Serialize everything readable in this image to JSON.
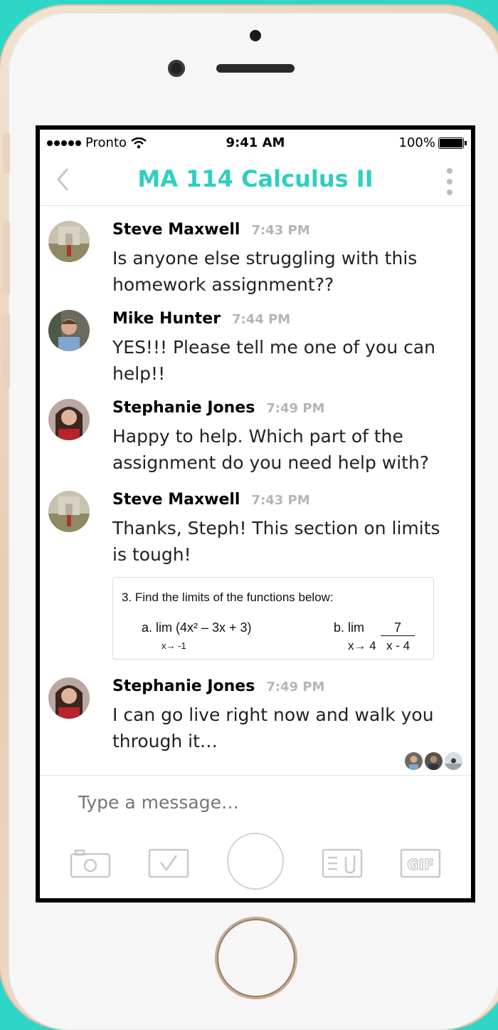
{
  "status_bar": {
    "carrier": "Pronto",
    "time": "9:41 AM",
    "battery": "100%"
  },
  "header": {
    "title": "MA 114 Calculus II",
    "back_icon": "chevron-left-icon",
    "menu_icon": "more-vertical-icon"
  },
  "colors": {
    "accent": "#2ecfc1",
    "background": "#2ed6c8",
    "timestamp": "#b5b5b5"
  },
  "messages": [
    {
      "sender": "Steve Maxwell",
      "time": "7:43 PM",
      "text": "Is anyone else struggling with this homework assignment??"
    },
    {
      "sender": "Mike Hunter",
      "time": "7:44 PM",
      "text": "YES!!! Please tell me one of you can help!!"
    },
    {
      "sender": "Stephanie Jones",
      "time": "7:49 PM",
      "text": "Happy to help. Which part of the assignment do you need help with?"
    },
    {
      "sender": "Steve Maxwell",
      "time": "7:43 PM",
      "text": "Thanks, Steph! This section on limits is tough!"
    },
    {
      "sender": "Stephanie Jones",
      "time": "7:49 PM",
      "text": "I can go live right now and walk you through it…"
    }
  ],
  "attachment": {
    "question": "3.  Find the limits of the functions below:",
    "part_a": "a.   lim (4x² – 3x + 3)",
    "part_a_sub": "x→ -1",
    "part_b": "b.  lim",
    "part_b_num": "7",
    "part_b_sub": "x→ 4",
    "part_b_den": "x - 4"
  },
  "composer": {
    "placeholder": "Type a message…",
    "tools": [
      "camera-icon",
      "checkbox-icon",
      "record-button",
      "attach-document-icon",
      "gif-icon"
    ],
    "gif_label": "GIF"
  }
}
